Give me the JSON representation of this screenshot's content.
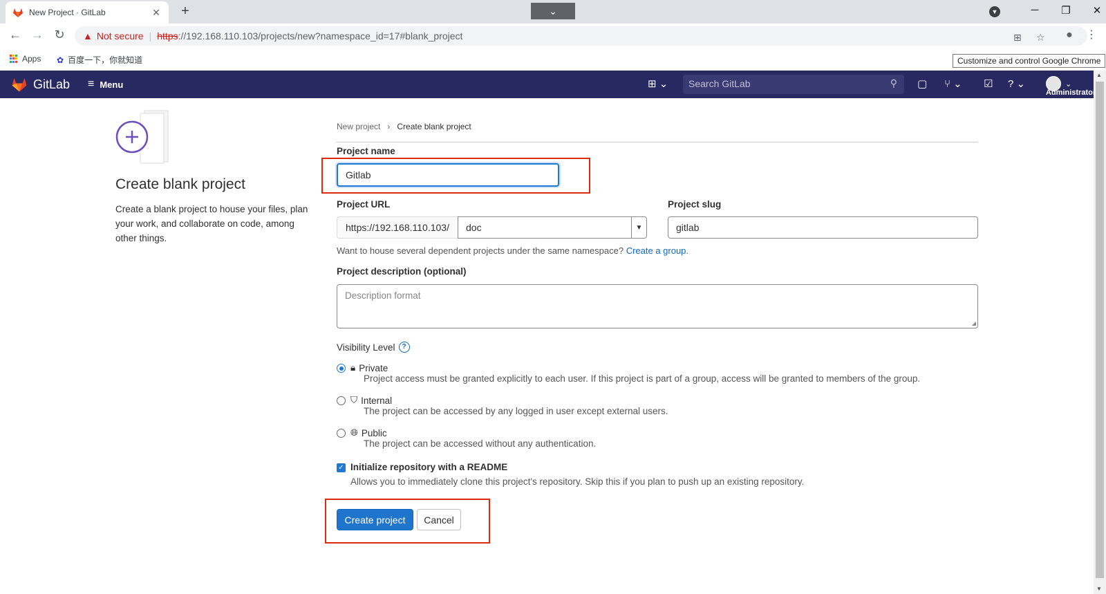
{
  "browser": {
    "tab_title": "New Project · GitLab",
    "tab_close": "✕",
    "new_tab": "+",
    "not_secure": "Not secure",
    "url_scheme": "https",
    "url_rest": "://192.168.110.103/projects/new?namespace_id=17#blank_project",
    "bookmarks": {
      "apps": "Apps",
      "baidu": "百度一下，你就知道"
    },
    "tooltip": "Customize and control Google Chrome"
  },
  "gitlab_header": {
    "brand": "GitLab",
    "menu_label": "Menu",
    "search_placeholder": "Search GitLab",
    "user_label": "Administrator"
  },
  "left_panel": {
    "title": "Create blank project",
    "description": "Create a blank project to house your files, plan your work, and collaborate on code, among other things."
  },
  "breadcrumb": {
    "parent": "New project",
    "current": "Create blank project"
  },
  "form": {
    "project_name_label": "Project name",
    "project_name_value": "Gitlab",
    "project_url_label": "Project URL",
    "url_prefix": "https://192.168.110.103/",
    "namespace_value": "doc",
    "project_slug_label": "Project slug",
    "project_slug_value": "gitlab",
    "namespace_help": "Want to house several dependent projects under the same namespace?",
    "create_group_link": "Create a group.",
    "description_label": "Project description (optional)",
    "description_placeholder": "Description format",
    "visibility_label": "Visibility Level",
    "visibility_help_icon": "?",
    "visibility": [
      {
        "title": "Private",
        "desc": "Project access must be granted explicitly to each user. If this project is part of a group, access will be granted to members of the group.",
        "selected": true
      },
      {
        "title": "Internal",
        "desc": "The project can be accessed by any logged in user except external users.",
        "selected": false
      },
      {
        "title": "Public",
        "desc": "The project can be accessed without any authentication.",
        "selected": false
      }
    ],
    "readme_checkbox_mark": "✓",
    "readme_label": "Initialize repository with a README",
    "readme_desc": "Allows you to immediately clone this project's repository. Skip this if you plan to push up an existing repository.",
    "create_button": "Create project",
    "cancel_button": "Cancel"
  },
  "colors": {
    "header_bg": "#292961",
    "primary": "#1f75cb",
    "highlight_box": "#dd2b0e"
  }
}
